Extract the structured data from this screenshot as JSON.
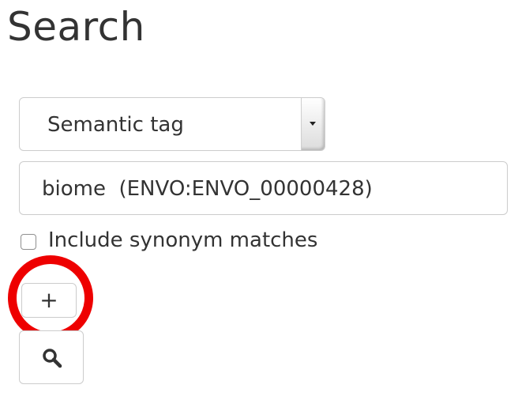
{
  "page": {
    "title": "Search"
  },
  "search_form": {
    "field_type_select": {
      "selected": "Semantic tag"
    },
    "tag_input": {
      "value": "biome  (ENVO:ENVO_00000428)"
    },
    "synonym_checkbox": {
      "label": "Include synonym matches",
      "checked": false
    },
    "add_button": {
      "label": "+"
    },
    "search_button": {
      "icon": "search-icon"
    }
  },
  "annotation": {
    "highlight_color": "#ee0000",
    "target": "add_button"
  }
}
